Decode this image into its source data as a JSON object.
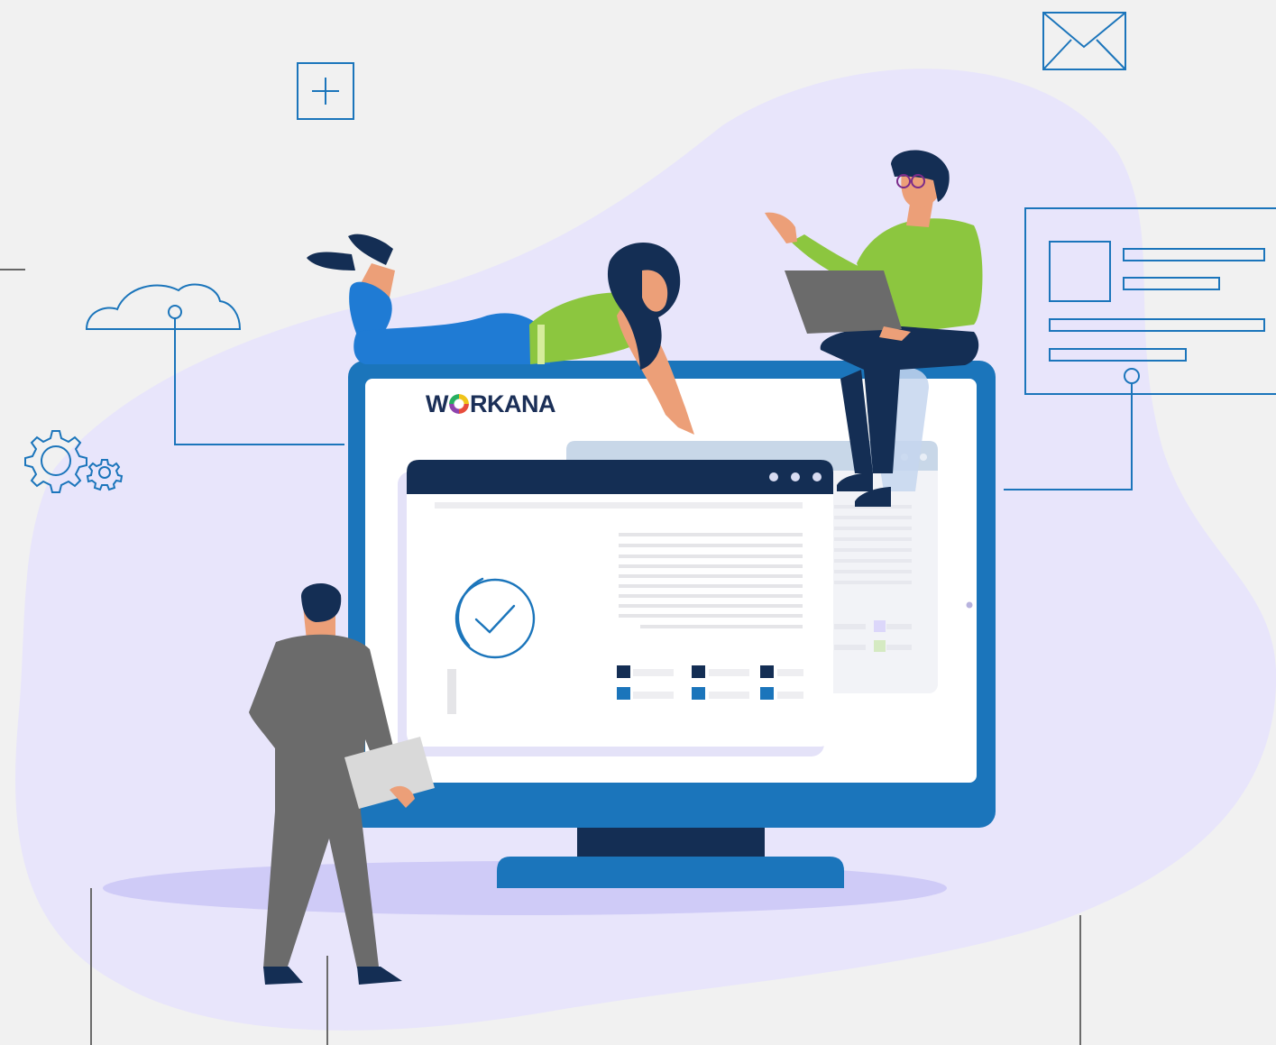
{
  "brand": {
    "pre": "W",
    "post": "RKANA"
  },
  "colors": {
    "background": "#f1f1f1",
    "blob": "#e8e5fb",
    "monitor_frame": "#1b75bb",
    "monitor_stand": "#142e54",
    "window_titlebar": "#142e54",
    "line_icon": "#1b75bb",
    "shirt_green": "#8cc63f",
    "pants_blue": "#1f7bd4",
    "suit_gray": "#6b6b6b"
  },
  "icons": [
    "plus-square-icon",
    "envelope-icon",
    "cloud-icon",
    "gears-icon",
    "checkmark-circle-icon",
    "form-card-icon"
  ],
  "window": {
    "dots": 3,
    "status": "complete"
  }
}
